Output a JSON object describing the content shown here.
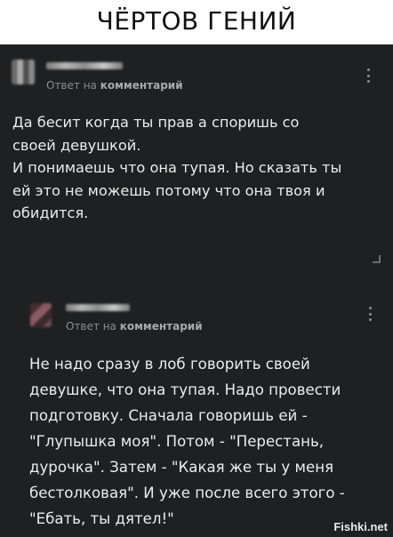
{
  "meme": {
    "title": "ЧЁРТОВ ГЕНИЙ"
  },
  "comments": [
    {
      "reply_prefix": "Ответ на ",
      "reply_target": "комментарий",
      "text": "Да бесит когда ты прав а споришь со\nсвоей девушкой.\nИ понимаешь что она тупая. Но сказать ты\nей это не можешь потому что она твоя и\nобидится."
    },
    {
      "reply_prefix": "Ответ на ",
      "reply_target": "комментарий",
      "text": "Не надо сразу в лоб говорить своей\nдевушке, что она тупая. Надо провести\nподготовку. Сначала говоришь ей -\n\"Глупышка моя\". Потом - \"Перестань,\nдурочка\". Затем - \"Какая же ты у меня\nбестолковая\". И уже после всего этого -\n\"Ебать, ты дятел!\""
    }
  ],
  "watermark": "Fishki.net",
  "colors": {
    "background": "#1e2022",
    "text": "#ececec",
    "meta": "#8a8c8f"
  }
}
